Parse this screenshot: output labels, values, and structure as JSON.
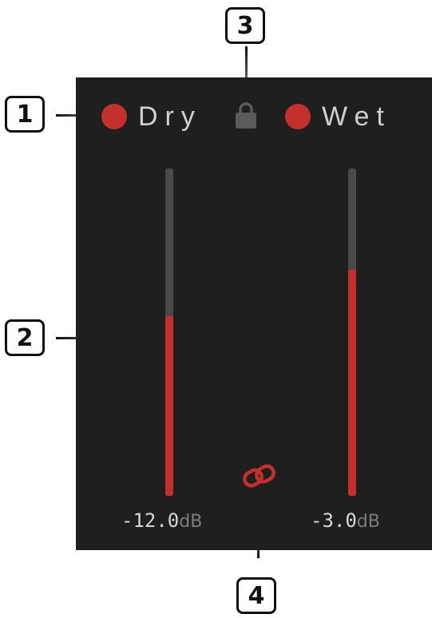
{
  "panel": {
    "dry": {
      "label": "Dry",
      "led_color": "#c4302b",
      "level_fraction": 0.55,
      "readout_value": "-12.0",
      "unit": "dB"
    },
    "wet": {
      "label": "Wet",
      "led_color": "#c4302b",
      "level_fraction": 0.69,
      "readout_value": "-3.0",
      "unit": "dB"
    },
    "lock": {
      "icon": "lock-icon"
    },
    "link": {
      "icon": "link-icon",
      "color": "#c4302b"
    }
  },
  "callouts": [
    "1",
    "2",
    "3",
    "4"
  ]
}
